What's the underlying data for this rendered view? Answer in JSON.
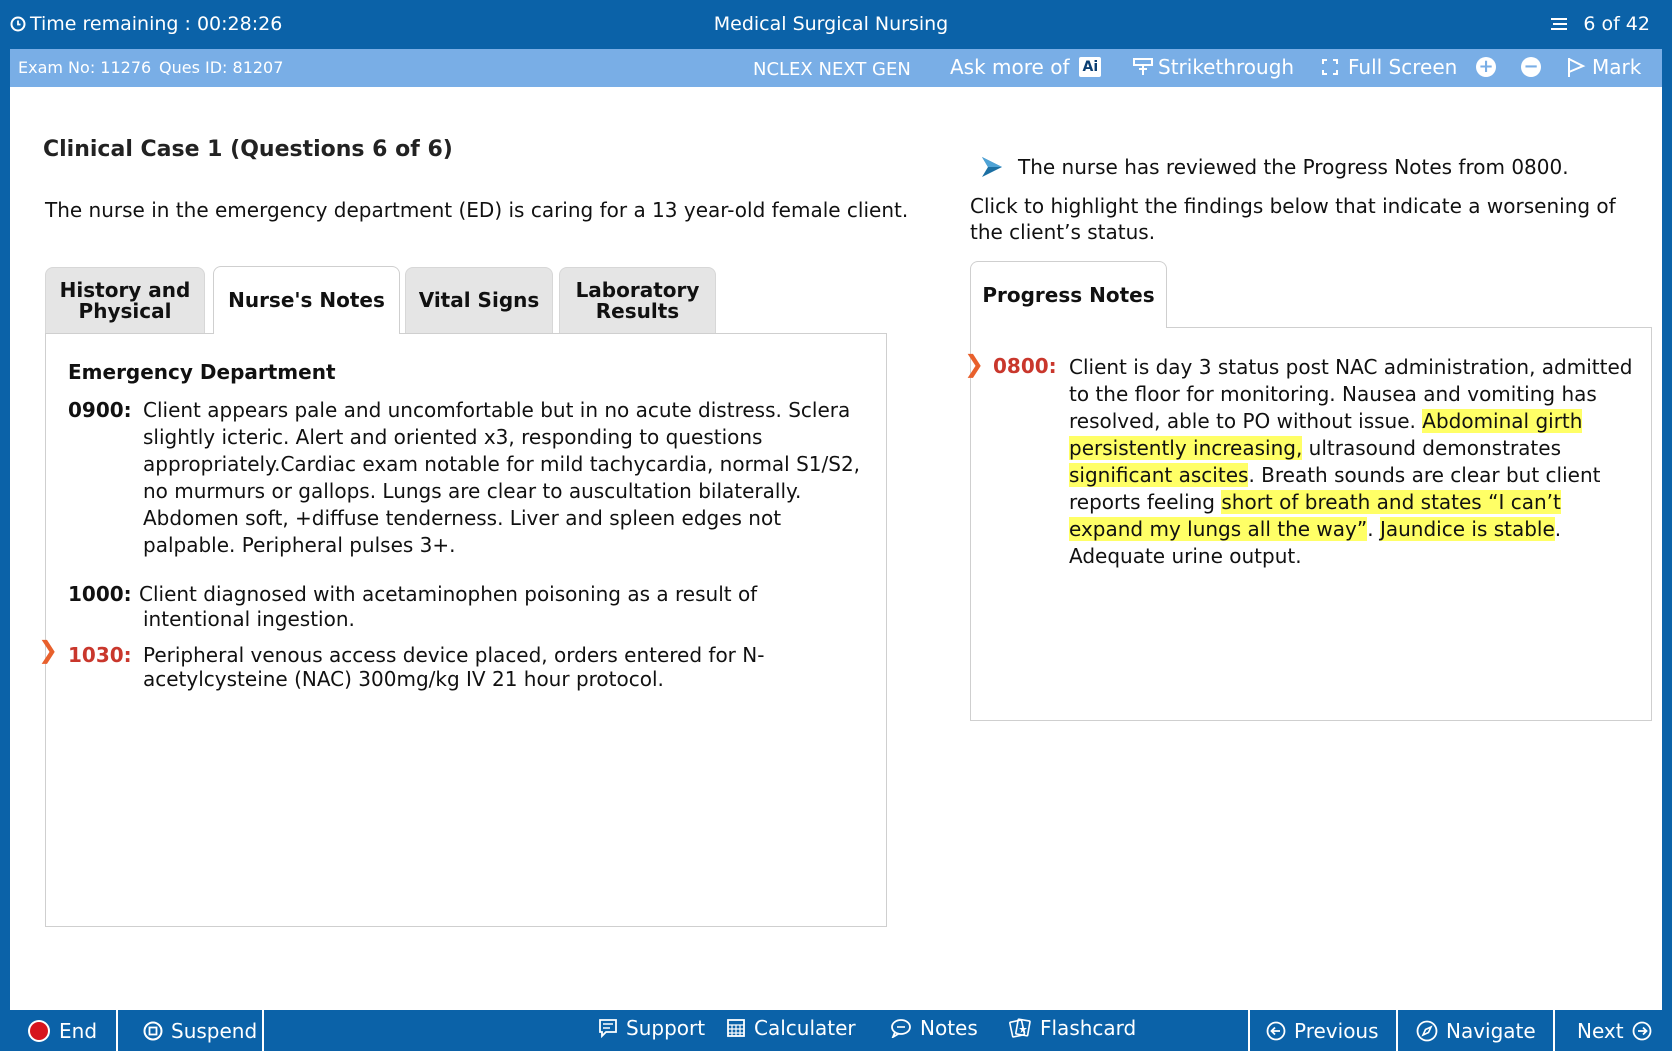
{
  "header": {
    "timer_label": "Time remaining : 00:28:26",
    "title": "Medical Surgical Nursing",
    "question_counter": "6 of  42"
  },
  "subheader": {
    "exam_no": "Exam No: 11276",
    "ques_id": "Ques ID: 81207",
    "exam_type": "NCLEX NEXT GEN",
    "ask_more": "Ask more of",
    "ai_badge": "Ai",
    "strikethrough": "Strikethrough",
    "full_screen": "Full Screen",
    "mark": "Mark"
  },
  "case": {
    "title": "Clinical Case 1 (Questions 6 of 6)",
    "description": "The nurse in the emergency department (ED) is caring for a 13 year-old female client."
  },
  "tabs": {
    "history": {
      "line1": "History and",
      "line2": "Physical"
    },
    "nurses_notes": "Nurse's Notes",
    "vital_signs": "Vital Signs",
    "lab": {
      "line1": "Laboratory",
      "line2": "Results"
    }
  },
  "nurses_notes": {
    "heading": "Emergency Department",
    "entries": [
      {
        "time": "0900:",
        "lines": [
          "Client appears pale and uncomfortable but in no acute distress. Sclera",
          "slightly icteric. Alert and oriented x3, responding to questions",
          "appropriately.Cardiac exam notable for mild tachycardia, normal S1/S2,",
          "no murmurs or gallops. Lungs are clear to auscultation bilaterally.",
          "Abdomen soft, +diffuse tenderness. Liver and spleen edges not",
          "palpable. Peripheral pulses 3+."
        ]
      },
      {
        "time": "1000:",
        "lines": [
          "Client diagnosed with acetaminophen poisoning as a result of",
          "intentional ingestion."
        ]
      },
      {
        "time": "1030:",
        "lines": [
          "Peripheral venous access device placed, orders entered for N-",
          "acetylcysteine (NAC) 300mg/kg IV 21 hour protocol."
        ]
      }
    ]
  },
  "prompt": {
    "line1": "The nurse has reviewed the Progress Notes from 0800.",
    "line2": "Click to highlight the findings below that indicate a worsening of the client’s status."
  },
  "progress_notes": {
    "tab_label": "Progress Notes",
    "time": "0800:",
    "segments": [
      {
        "text": "Client is day 3 status post NAC administration, admitted to the floor for monitoring. Nausea and vomiting has resolved, able to PO without issue. ",
        "highlight": false
      },
      {
        "text": "Abdominal girth persistently increasing,",
        "highlight": true
      },
      {
        "text": " ultrasound demonstrates ",
        "highlight": false
      },
      {
        "text": "significant ascites",
        "highlight": true
      },
      {
        "text": ". Breath sounds are clear but client reports feeling ",
        "highlight": false
      },
      {
        "text": "short of breath and states “I can’t expand my lungs all the way”",
        "highlight": true
      },
      {
        "text": ". ",
        "highlight": false
      },
      {
        "text": "Jaundice is stable",
        "highlight": true
      },
      {
        "text": ". Adequate urine output.",
        "highlight": false
      }
    ]
  },
  "footer": {
    "end": "End",
    "suspend": "Suspend",
    "support": "Support",
    "calculator": "Calculater",
    "notes": "Notes",
    "flashcard": "Flashcard",
    "previous": "Previous",
    "navigate": "Navigate",
    "next": "Next"
  },
  "colors": {
    "header_blue": "#0b62a8",
    "subheader_blue": "#79aee6",
    "time_red": "#c9372c",
    "chevron_orange": "#e8602c",
    "highlight_yellow": "#ffff66"
  }
}
